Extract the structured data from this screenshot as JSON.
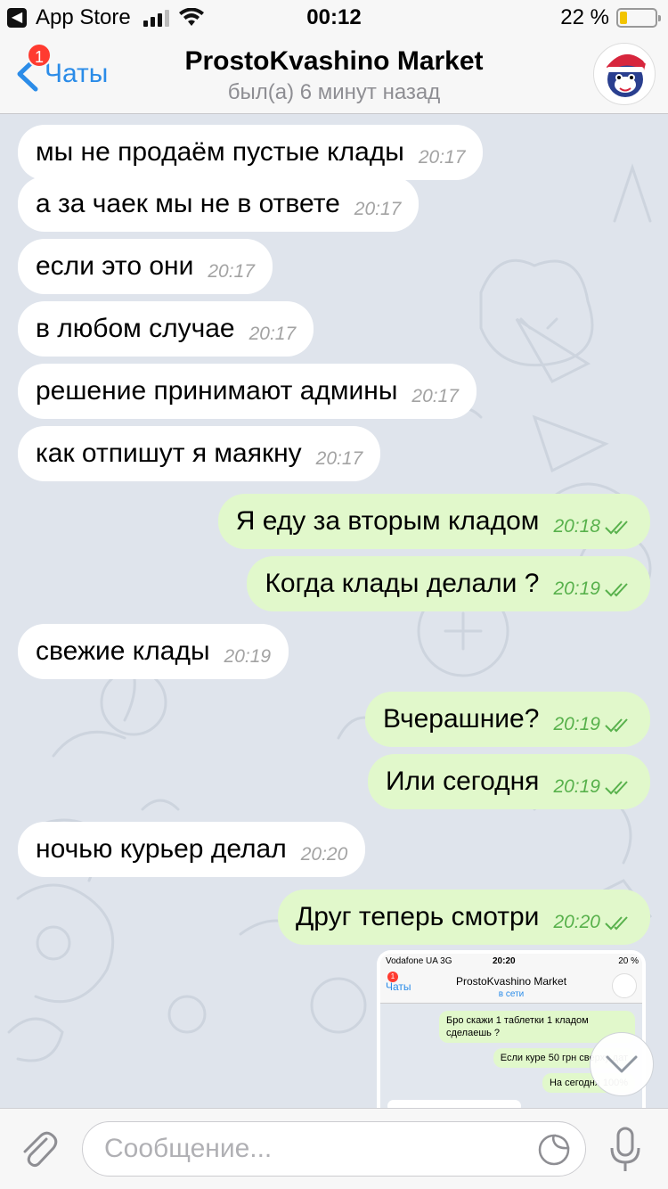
{
  "status_bar": {
    "back_app": "App Store",
    "time": "00:12",
    "battery": "22 %",
    "battery_level": 0.22
  },
  "nav": {
    "back_label": "Чаты",
    "badge": "1",
    "title": "ProstoKvashino Market",
    "subtitle": "был(а) 6 минут назад"
  },
  "messages": [
    {
      "dir": "in",
      "text": "мы не продаём пустые клады",
      "time": "20:17"
    },
    {
      "dir": "in",
      "text": "а за чаек мы не в ответе",
      "time": "20:17"
    },
    {
      "dir": "in",
      "text": "если это они",
      "time": "20:17"
    },
    {
      "dir": "in",
      "text": "в любом случае",
      "time": "20:17"
    },
    {
      "dir": "in",
      "text": "решение принимают админы",
      "time": "20:17"
    },
    {
      "dir": "in",
      "text": "как отпишут я маякну",
      "time": "20:17"
    },
    {
      "dir": "out",
      "text": "Я еду за вторым кладом",
      "time": "20:18"
    },
    {
      "dir": "out",
      "text": "Когда клады делали ?",
      "time": "20:19"
    },
    {
      "dir": "in",
      "text": "свежие клады",
      "time": "20:19"
    },
    {
      "dir": "out",
      "text": "Вчерашние?",
      "time": "20:19"
    },
    {
      "dir": "out",
      "text": "Или сегодня",
      "time": "20:19"
    },
    {
      "dir": "in",
      "text": "ночью курьер делал",
      "time": "20:20"
    },
    {
      "dir": "out",
      "text": "Друг теперь смотри",
      "time": "20:20"
    }
  ],
  "media": {
    "carrier": "Vodafone UA  3G",
    "time": "20:20",
    "battery": "20 %",
    "back_label": "Чаты",
    "badge": "1",
    "title": "ProstoKvashino Market",
    "subtitle": "в сети",
    "msg1": "Бро скажи 1 таблетки 1 кладом сделаешь ?",
    "msg2": "Если куре 50 грн сверху дат",
    "msg3": "На сегодня 100%"
  },
  "input": {
    "placeholder": "Сообщение..."
  },
  "icons": {
    "attach": "paperclip-icon",
    "sticker": "sticker-icon",
    "mic": "microphone-icon",
    "scroll": "chevron-down-icon"
  },
  "colors": {
    "accent": "#2b8ce8",
    "outgoing_bubble": "#e1f8cb",
    "outgoing_time": "#58b14c",
    "badge": "#ff3b30"
  }
}
